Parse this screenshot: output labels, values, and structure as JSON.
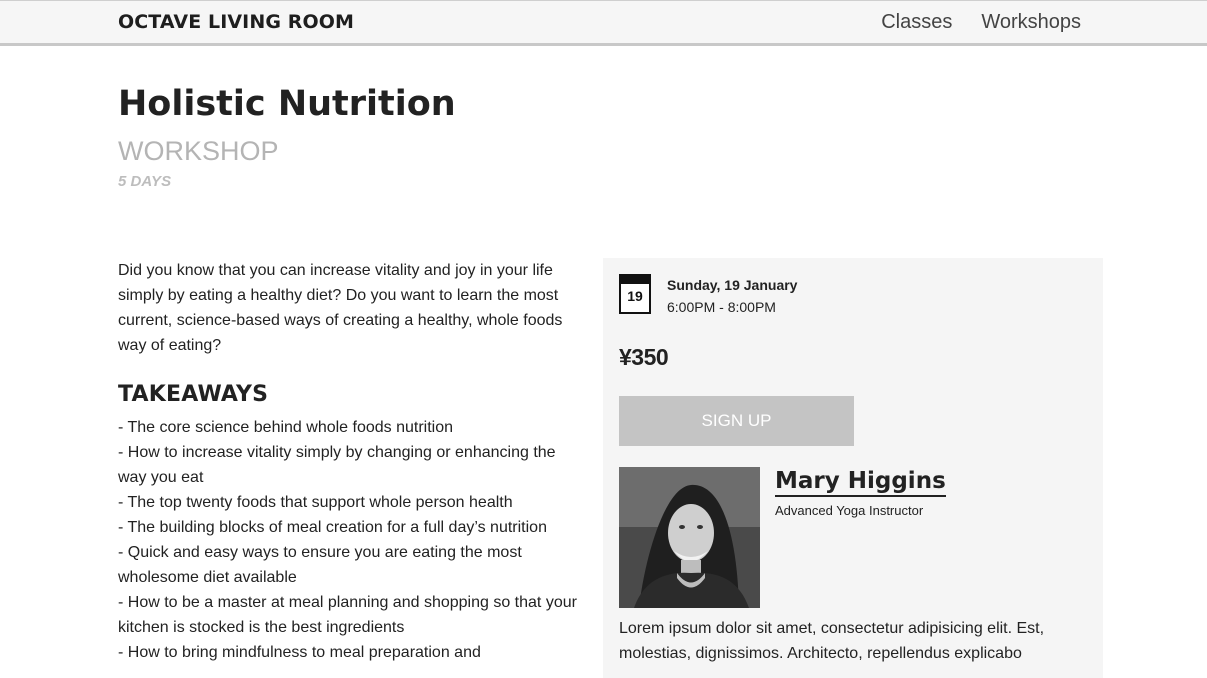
{
  "header": {
    "brand": "OCTAVE LIVING ROOM",
    "nav": [
      {
        "label": "Classes"
      },
      {
        "label": "Workshops"
      }
    ]
  },
  "page": {
    "title": "Holistic Nutrition",
    "subtitle": "WORKSHOP",
    "duration": "5 DAYS"
  },
  "content": {
    "intro": "Did you know that you can increase vitality and joy in your life simply by eating a healthy diet? Do you want to learn the most current, science-based ways of creating a healthy, whole foods way of eating?",
    "takeaways_heading": "TAKEAWAYS",
    "takeaways": [
      "- The core science behind whole foods nutrition",
      "- How to increase vitality simply by changing or enhancing the way you eat",
      "- The top twenty foods that support whole person health",
      "- The building blocks of meal creation for a full day’s nutrition",
      "- Quick and easy ways to ensure you are eating the most wholesome diet available",
      "- How to be a master at meal planning and shopping so that your kitchen is stocked is the best ingredients",
      "- How to bring mindfulness to meal preparation and"
    ]
  },
  "event": {
    "calendar_day": "19",
    "date": "Sunday, 19 January",
    "time": "6:00PM - 8:00PM",
    "price": "¥350",
    "signup_label": "SIGN UP"
  },
  "instructor": {
    "name": "Mary Higgins",
    "role": "Advanced Yoga Instructor",
    "bio": "Lorem ipsum dolor sit amet, consectetur adipisicing elit. Est, molestias, dignissimos. Architecto, repellendus explicabo"
  }
}
